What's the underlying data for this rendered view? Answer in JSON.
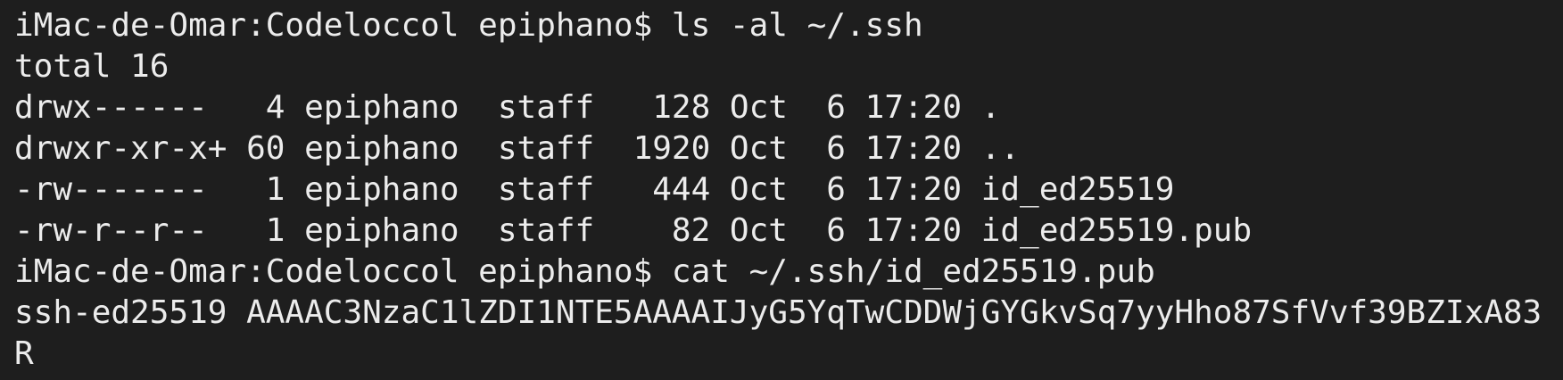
{
  "terminal": {
    "lines": [
      "iMac-de-Omar:Codeloccol epiphano$ ls -al ~/.ssh",
      "total 16",
      "drwx------   4 epiphano  staff   128 Oct  6 17:20 .",
      "drwxr-xr-x+ 60 epiphano  staff  1920 Oct  6 17:20 ..",
      "-rw-------   1 epiphano  staff   444 Oct  6 17:20 id_ed25519",
      "-rw-r--r--   1 epiphano  staff    82 Oct  6 17:20 id_ed25519.pub",
      "iMac-de-Omar:Codeloccol epiphano$ cat ~/.ssh/id_ed25519.pub",
      "ssh-ed25519 AAAAC3NzaC1lZDI1NTE5AAAAIJyG5YqTwCDDWjGYGkvSq7yyHho87SfVvf39BZIxA83",
      "R"
    ],
    "colors": {
      "background": "#1e1e1e",
      "text": "#ececec"
    }
  }
}
